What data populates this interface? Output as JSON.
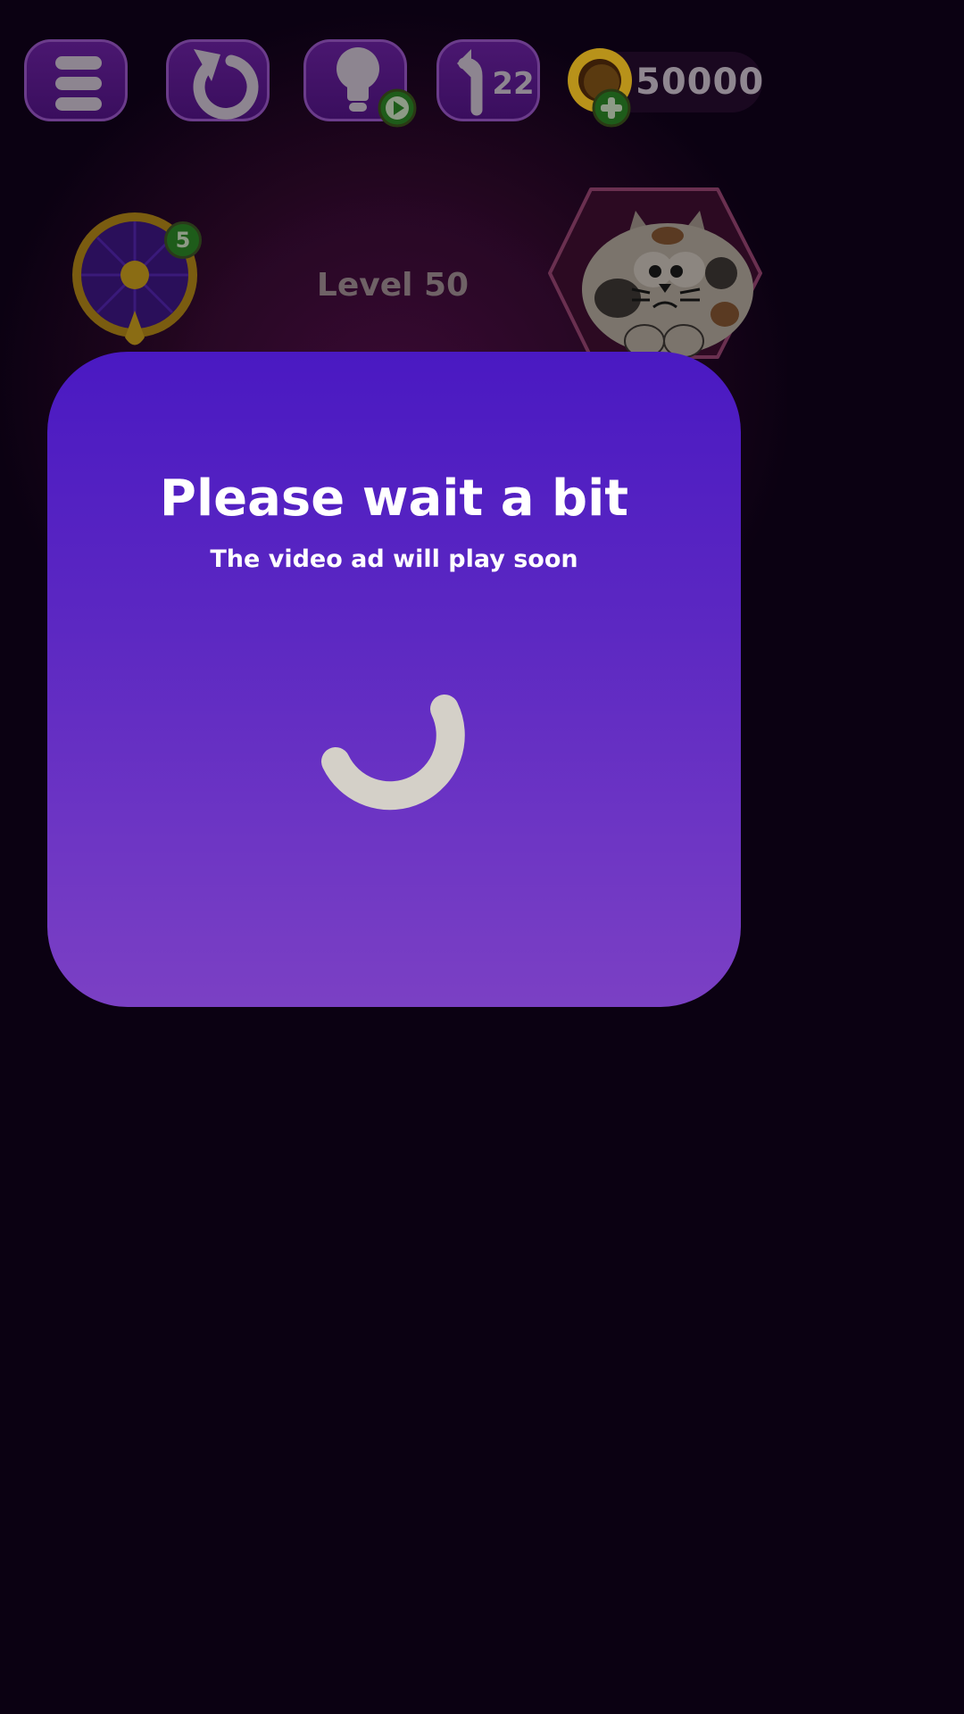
{
  "toolbar": {
    "menu_icon": "hamburger-menu-icon",
    "restart_icon": "restart-icon",
    "hint_icon": "lightbulb-icon",
    "hint_badge_icon": "play-video-icon",
    "undo_icon": "undo-arrow-icon",
    "undo_count": "22"
  },
  "coins": {
    "icon": "gold-coin-icon",
    "add_icon": "plus-icon",
    "value": "50000"
  },
  "level": {
    "label": "Level 50"
  },
  "wheel": {
    "icon": "fortune-wheel-icon",
    "badge": "5"
  },
  "mascot": {
    "icon": "cat-mascot-icon"
  },
  "dialog": {
    "title": "Please wait a bit",
    "subtitle": "The video ad will play soon",
    "loading_icon": "loading-spinner-icon"
  },
  "colors": {
    "dialog_top": "#4a19c2",
    "dialog_bottom": "#7b40c4",
    "spinner": "#d4d0c8",
    "badge_green": "#1e5c1a",
    "coin_gold": "#b8921a"
  }
}
